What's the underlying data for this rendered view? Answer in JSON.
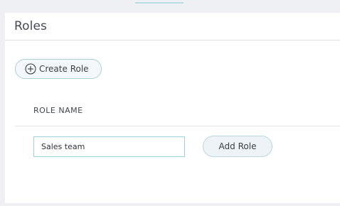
{
  "page": {
    "title": "Roles"
  },
  "toolbar": {
    "create_role_label": "Create Role",
    "create_role_icon": "plus-circle-icon"
  },
  "table": {
    "columns": [
      "ROLE NAME"
    ]
  },
  "new_role_form": {
    "input_value": "Sales team",
    "add_button_label": "Add Role"
  },
  "colors": {
    "accent_border": "#9fd0de",
    "button_background": "#edf3f6",
    "text": "#3a3f47"
  }
}
